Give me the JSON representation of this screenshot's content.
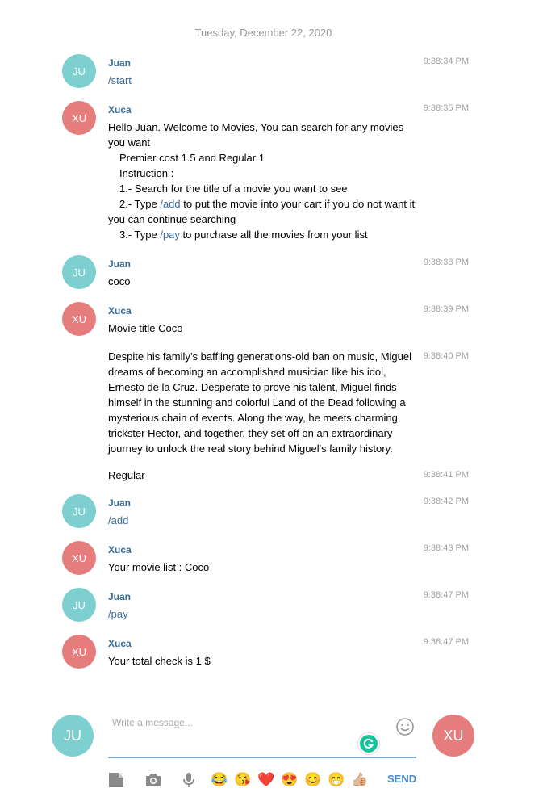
{
  "date": "Tuesday, December 22, 2020",
  "messages": [
    {
      "sender": "Juan",
      "avatar": "JU",
      "time": "9:38:34 PM",
      "text": "/start"
    },
    {
      "sender": "Xuca",
      "avatar": "XU",
      "time": "9:38:35 PM",
      "lines": {
        "l1": "Hello Juan. Welcome to Movies, You can search for any movies you want",
        "l2": "Premier cost 1.5 and Regular 1",
        "l3": "Instruction :",
        "l4": "1.- Search for the title of a movie you want to see",
        "l5a": "2.- Type ",
        "l5cmd": "/add",
        "l5b": " to put the movie into your cart if you do not want it you can continue searching",
        "l6a": "3.- Type ",
        "l6cmd": "/pay",
        "l6b": " to purchase all the movies from your list"
      }
    },
    {
      "sender": "Juan",
      "avatar": "JU",
      "time": "9:38:38 PM",
      "text": "coco"
    },
    {
      "sender": "Xuca",
      "avatar": "XU",
      "time": "9:38:39 PM",
      "text": "Movie title Coco"
    },
    {
      "time": "9:38:40 PM",
      "text": "Despite his family’s baffling generations-old ban on music, Miguel dreams of becoming an accomplished musician like his idol, Ernesto de la Cruz. Desperate to prove his talent, Miguel finds himself in the stunning and colorful Land of the Dead following a mysterious chain of events. Along the way, he meets charming trickster Hector, and together, they set off on an extraordinary journey to unlock the real story behind Miguel's family history."
    },
    {
      "time": "9:38:41 PM",
      "text": "Regular"
    },
    {
      "sender": "Juan",
      "avatar": "JU",
      "time": "9:38:42 PM",
      "text": "/add"
    },
    {
      "sender": "Xuca",
      "avatar": "XU",
      "time": "9:38:43 PM",
      "text": "Your movie list : Coco"
    },
    {
      "sender": "Juan",
      "avatar": "JU",
      "time": "9:38:47 PM",
      "text": "/pay"
    },
    {
      "sender": "Xuca",
      "avatar": "XU",
      "time": "9:38:47 PM",
      "text": "Your total check is  1 $"
    }
  ],
  "composer": {
    "placeholder": "Write a message...",
    "left_avatar": "JU",
    "right_avatar": "XU",
    "send_label": "SEND",
    "emojis": [
      "😂",
      "😘",
      "❤️",
      "😍",
      "😊",
      "😁",
      "👍🏼"
    ]
  },
  "colors": {
    "ju": "#7ecfd0",
    "xu": "#e57d7d",
    "accent": "#4a8ec7",
    "name": "#3a6d99"
  },
  "icons": [
    "file-icon",
    "camera-icon",
    "microphone-icon",
    "smiley-icon",
    "grammarly-icon"
  ]
}
